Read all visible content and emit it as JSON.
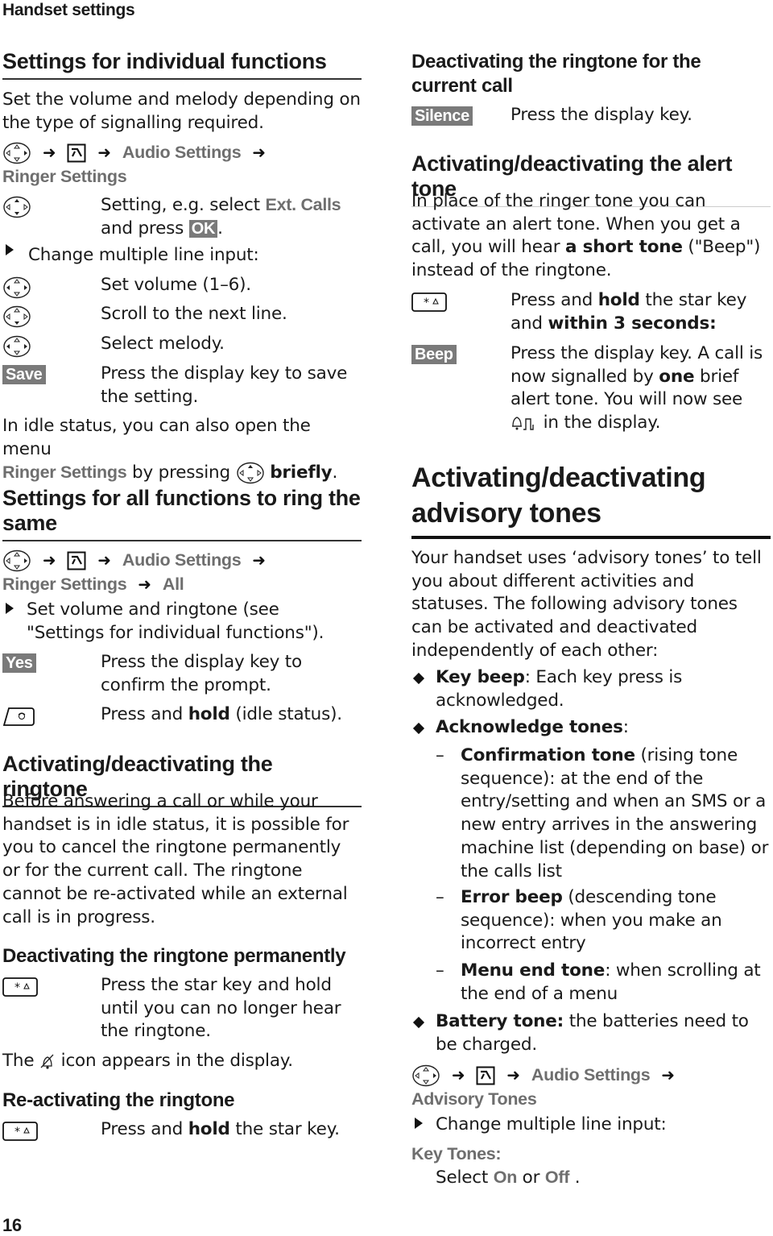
{
  "page": {
    "header": "Handset settings",
    "number": "16"
  },
  "left": {
    "s1": {
      "title": "Settings for individual functions",
      "intro": "Set the volume and melody depending on the type of signalling required.",
      "path": [
        "Audio Settings",
        "Ringer Settings"
      ],
      "step1_a": "Setting, e.g. select ",
      "step1_menu": "Ext. Calls",
      "step1_b": "and press ",
      "step1_key": "OK",
      "step1_c": ".",
      "change": "Change multiple line input:",
      "step2": "Set volume (1–6).",
      "step3": "Scroll to the next line.",
      "step4": "Select melody.",
      "save_key": "Save",
      "step5": "Press the display key to save the setting.",
      "idle_a": "In idle status, you can also open the menu ",
      "idle_menu": "Ringer Settings",
      "idle_b": " by pressing ",
      "idle_bold": "briefly",
      "idle_c": "."
    },
    "s2": {
      "title": "Settings for all functions to ring the same",
      "path": [
        "Audio Settings",
        "Ringer Settings",
        "All"
      ],
      "bullet": "Set volume and ringtone (see \"Settings for individual functions\").",
      "yes_key": "Yes",
      "yes_text": "Press the display key to confirm the prompt.",
      "end_a": "Press and ",
      "end_bold": "hold",
      "end_b": " (idle status)."
    },
    "s3": {
      "title": "Activating/deactivating the ringtone",
      "body": "Before answering a call or while your handset is in idle status, it is possible for you to cancel the ringtone permanently or for the current call. The ringtone cannot be re-activated while an external call is in progress.",
      "perm_title": "Deactivating the ringtone permanently",
      "perm_text": "Press the star key and hold until you can no longer hear the ringtone.",
      "icon_a": "The ",
      "icon_b": " icon appears in the display.",
      "react_title": "Re-activating the ringtone",
      "react_a": "Press and ",
      "react_bold": "hold",
      "react_b": " the star key."
    }
  },
  "right": {
    "current": {
      "title": "Deactivating the ringtone for the current call",
      "key": "Silence",
      "text": "Press the display key."
    },
    "alert": {
      "title": "Activating/deactivating the alert tone",
      "body_a": "In place of the ringer tone you can activate an alert tone. When you get a call, you will hear ",
      "body_bold": "a short tone",
      "body_b": " (\"Beep\") instead of the ringtone.",
      "star_a": "Press and ",
      "star_bold1": "hold",
      "star_b": " the star key and ",
      "star_bold2": "within 3 seconds:",
      "beep_key": "Beep",
      "beep_a": "Press the display key. A call is now signalled by ",
      "beep_bold": "one",
      "beep_b": " brief alert tone. You will now see ",
      "beep_c": " in the display."
    },
    "advisory": {
      "title": "Activating/deactivating advisory tones",
      "body": "Your handset uses ‘advisory tones’ to tell you about different activities and statuses. The following advisory tones can be activated and deactivated independently of each other:",
      "items": [
        {
          "bold": "Key beep",
          "text": ": Each key press is acknowledged."
        },
        {
          "bold": "Acknowledge tones",
          "text": ":"
        },
        {
          "bold": "Battery tone:",
          "text": " the batteries need to be charged."
        }
      ],
      "subitems": [
        {
          "bold": "Confirmation tone",
          "text": " (rising tone sequence): at the end of the entry/setting and when an SMS or a new entry arrives in the answering machine list (depending on base) or the calls list"
        },
        {
          "bold": "Error beep",
          "text": " (descending tone sequence): when you make an incorrect entry"
        },
        {
          "bold": "Menu end tone",
          "text": ": when scrolling at the end of a menu"
        }
      ],
      "path": [
        "Audio Settings",
        "Advisory Tones"
      ],
      "change": "Change multiple line input:",
      "key_tones": "Key Tones:",
      "select_a": "Select ",
      "on": "On",
      "or": " or ",
      "off": "Off",
      "select_b": " ."
    }
  }
}
